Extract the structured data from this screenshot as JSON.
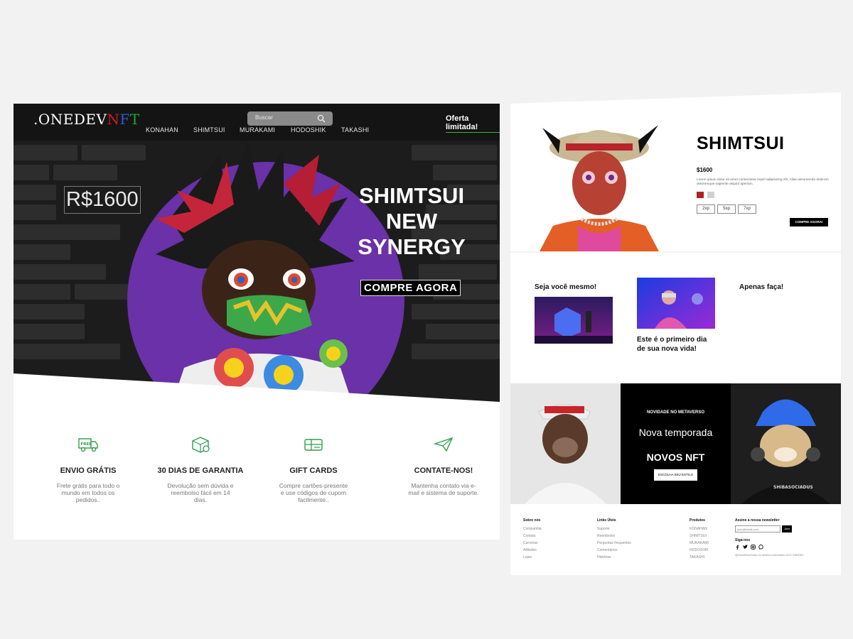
{
  "left_page": {
    "logo": {
      "part1": ".ONEDEV",
      "n": "N",
      "f": "F",
      "t": "T"
    },
    "search": {
      "placeholder": "Buscar"
    },
    "nav": [
      "KONAHAN",
      "SHIMTSUI",
      "MURAKAMI",
      "HODOSHIK",
      "TAKASHI"
    ],
    "offer": "Oferta limitada!",
    "hero": {
      "price": "R$1600",
      "title_lines": [
        "SHIMTSUI",
        "NEW",
        "SYNERGY"
      ],
      "button": "COMPRE AGORA"
    },
    "features": [
      {
        "icon": "free-truck-icon",
        "title": "ENVIO GRÁTIS",
        "desc": "Frete grátis para todo o mundo em todos os pedidos.."
      },
      {
        "icon": "box-return-icon",
        "title": "30 DIAS DE GARANTIA",
        "desc": "Devolução sem dúvida e reembolso fácil em 14 dias."
      },
      {
        "icon": "gift-card-icon",
        "title": "GIFT CARDS",
        "desc": "Compre cartões-presente e use códigos de cupom facilmente.."
      },
      {
        "icon": "paper-plane-icon",
        "title": "CONTATE-NOS!",
        "desc": "Mantenha contato via e-mail e sistema de suporte."
      }
    ],
    "colors": {
      "nav_bg": "#141414",
      "hero_circle": "#6a31a8",
      "accent_green": "#3cb43c"
    }
  },
  "right_page": {
    "product": {
      "title": "SHIMTSUI",
      "price": "$1600",
      "desc": "Lorem ipsum dolor sit amet consectetur impel adipisicing elit. Alias assumenda dolorum doloremque sapiente aliquid aperiam.",
      "swatches": [
        "#b12222",
        "#d0d0d0"
      ],
      "sizes": [
        "2xp",
        "5xp",
        "7xp"
      ],
      "button": "COMPRE AGORA!"
    },
    "mid": {
      "col1_title": "Seja você mesmo!",
      "col2_title": "Este é o primeiro dia de sua nova vida!",
      "col3_title": "Apenas faça!"
    },
    "banner": {
      "kicker": "NOVIDADE NO METAVERSO",
      "headline": "Nova temporada",
      "subhead": "NOVOS NFT",
      "button": "ESCOLHA SEU ESTILO",
      "shirt_text": "SHIBASOCIADUS"
    },
    "footer": {
      "about": {
        "title": "Sobre nós",
        "items": [
          "Companhia",
          "Contato",
          "Carreiras",
          "Afiliados",
          "Lojas"
        ]
      },
      "links": {
        "title": "Links Úteis",
        "items": [
          "Suporte",
          "Reembolso",
          "Perguntas frequentes",
          "Comentários",
          "Histórias"
        ]
      },
      "products": {
        "title": "Produtos",
        "items": [
          "KONAHAN",
          "SHIMTSUI",
          "MURAKAMI",
          "HODOSHIK",
          "TAKASHI"
        ]
      },
      "newsletter": {
        "title": "Assine a nossa newsletter",
        "placeholder": "your@email.com",
        "button": "Join!"
      },
      "follow": "Siga-nos",
      "social_icons": [
        "facebook-icon",
        "twitter-icon",
        "instagram-icon",
        "whatsapp-icon"
      ],
      "copyright": "@DavidSilvaTodos os direitos reservados 2022 ONEDEV."
    }
  }
}
